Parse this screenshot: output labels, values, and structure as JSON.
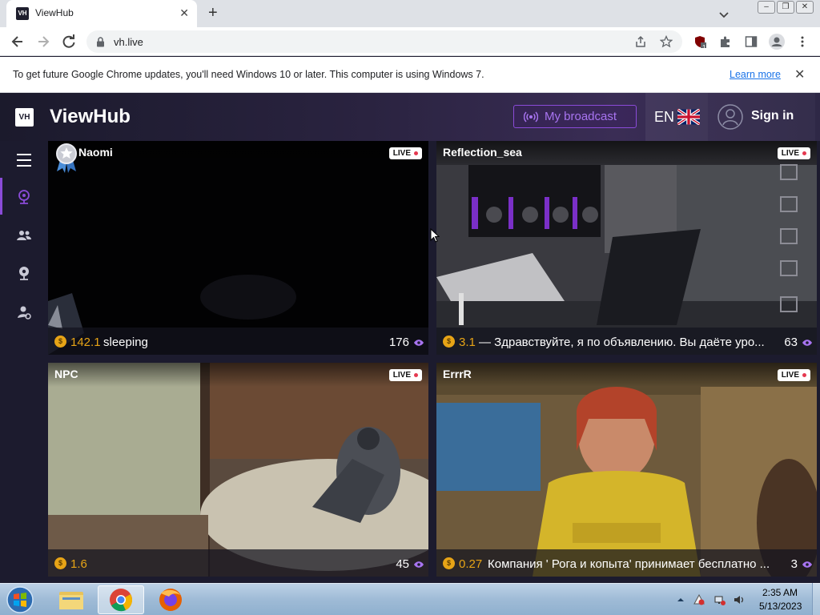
{
  "browser": {
    "tab_title": "ViewHub",
    "tab_favicon_text": "VH",
    "url": "vh.live",
    "extension_badge": "1"
  },
  "infobar": {
    "message": "To get future Google Chrome updates, you'll need Windows 10 or later. This computer is using Windows 7.",
    "link": "Learn more"
  },
  "site": {
    "logo_text": "VH",
    "brand": "ViewHub",
    "broadcast_label": "My broadcast",
    "language": "EN",
    "signin_label": "Sign in",
    "accent_color": "#8a4bd8",
    "coin_color": "#e7a416"
  },
  "sidebar": {
    "items": [
      {
        "icon": "menu-icon"
      },
      {
        "icon": "webcam-icon",
        "active": true
      },
      {
        "icon": "users-icon"
      },
      {
        "icon": "live-camera-icon"
      },
      {
        "icon": "user-settings-icon"
      }
    ]
  },
  "streams": [
    {
      "name": "Naomi",
      "badge": "award-badge-icon",
      "live": "LIVE",
      "coin": "$",
      "tips": "142.1",
      "topic": "sleeping",
      "viewers": "176"
    },
    {
      "name": "Reflection_sea",
      "live": "LIVE",
      "coin": "$",
      "tips": "3.1",
      "topic": "— Здравствуйте, я по объявлению. Вы даёте уро...",
      "viewers": "63"
    },
    {
      "name": "NPC",
      "live": "LIVE",
      "coin": "$",
      "tips": "1.6",
      "topic": "",
      "viewers": "45"
    },
    {
      "name": "ErrrR",
      "live": "LIVE",
      "coin": "$",
      "tips": "0.27",
      "topic": "Компания ' Рога и копыта' принимает бесплатно ...",
      "viewers": "3"
    }
  ],
  "taskbar": {
    "apps": [
      "explorer-icon",
      "chrome-icon",
      "firefox-icon"
    ],
    "time": "2:35 AM",
    "date": "5/13/2023"
  }
}
